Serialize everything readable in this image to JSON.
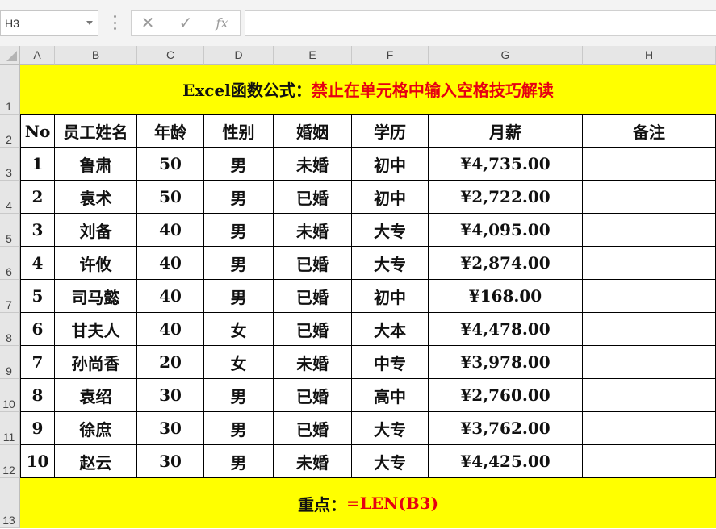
{
  "formula_bar": {
    "name_box": "H3",
    "cancel_icon": "✕",
    "enter_icon": "✓",
    "fx_label": "fx",
    "formula": ""
  },
  "columns": [
    "A",
    "B",
    "C",
    "D",
    "E",
    "F",
    "G",
    "H"
  ],
  "rows": [
    "1",
    "2",
    "3",
    "4",
    "5",
    "6",
    "7",
    "8",
    "9",
    "10",
    "11",
    "12",
    "13"
  ],
  "title": {
    "prefix": "Excel函数公式：",
    "highlight": "禁止在单元格中输入空格技巧解读"
  },
  "table": {
    "headers": [
      "No",
      "员工姓名",
      "年龄",
      "性别",
      "婚姻",
      "学历",
      "月薪",
      "备注"
    ],
    "rows": [
      [
        "1",
        "鲁肃",
        "50",
        "男",
        "未婚",
        "初中",
        "¥4,735.00",
        ""
      ],
      [
        "2",
        "袁术",
        "50",
        "男",
        "已婚",
        "初中",
        "¥2,722.00",
        ""
      ],
      [
        "3",
        "刘备",
        "40",
        "男",
        "未婚",
        "大专",
        "¥4,095.00",
        ""
      ],
      [
        "4",
        "许攸",
        "40",
        "男",
        "已婚",
        "大专",
        "¥2,874.00",
        ""
      ],
      [
        "5",
        "司马懿",
        "40",
        "男",
        "已婚",
        "初中",
        "¥168.00",
        ""
      ],
      [
        "6",
        "甘夫人",
        "40",
        "女",
        "已婚",
        "大本",
        "¥4,478.00",
        ""
      ],
      [
        "7",
        "孙尚香",
        "20",
        "女",
        "未婚",
        "中专",
        "¥3,978.00",
        ""
      ],
      [
        "8",
        "袁绍",
        "30",
        "男",
        "已婚",
        "高中",
        "¥2,760.00",
        ""
      ],
      [
        "9",
        "徐庶",
        "30",
        "男",
        "已婚",
        "大专",
        "¥3,762.00",
        ""
      ],
      [
        "10",
        "赵云",
        "30",
        "男",
        "未婚",
        "大专",
        "¥4,425.00",
        ""
      ]
    ]
  },
  "footer": {
    "prefix": "重点：",
    "highlight": "=LEN(B3)"
  },
  "colors": {
    "band": "#ffff00",
    "highlight_text": "#e60012",
    "header_bg": "#e6e6e6"
  }
}
